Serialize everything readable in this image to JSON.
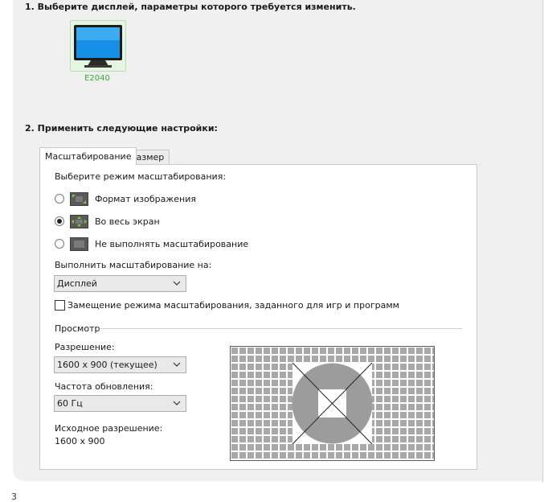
{
  "step1": {
    "title": "1. Выберите дисплей, параметры которого требуется изменить."
  },
  "display": {
    "name": "E2040",
    "icon": "monitor-icon",
    "accent": "#3aa52f"
  },
  "step2": {
    "title": "2. Применить следующие настройки:"
  },
  "tabs": [
    {
      "label": "Масштабирование",
      "active": true
    },
    {
      "label": "Размер",
      "active": false
    }
  ],
  "scaling": {
    "mode_label": "Выберите режим масштабирования:",
    "modes": [
      {
        "label": "Формат изображения",
        "icon": "aspect-ratio-icon",
        "selected": false
      },
      {
        "label": "Во весь экран",
        "icon": "full-screen-icon",
        "selected": true
      },
      {
        "label": "Не выполнять масштабирование",
        "icon": "no-scaling-icon",
        "selected": false
      }
    ],
    "perform_on_label": "Выполнить масштабирование на:",
    "perform_on_value": "Дисплей",
    "override_label": "Замещение режима масштабирования, заданного для игр и программ",
    "override_checked": false
  },
  "preview": {
    "section_label": "Просмотр",
    "resolution_label": "Разрешение:",
    "resolution_value": "1600 x 900 (текущее)",
    "refresh_label": "Частота обновления:",
    "refresh_value": "60 Гц",
    "native_label": "Исходное разрешение:",
    "native_value": "1600 x 900"
  },
  "step3_partial": "3"
}
